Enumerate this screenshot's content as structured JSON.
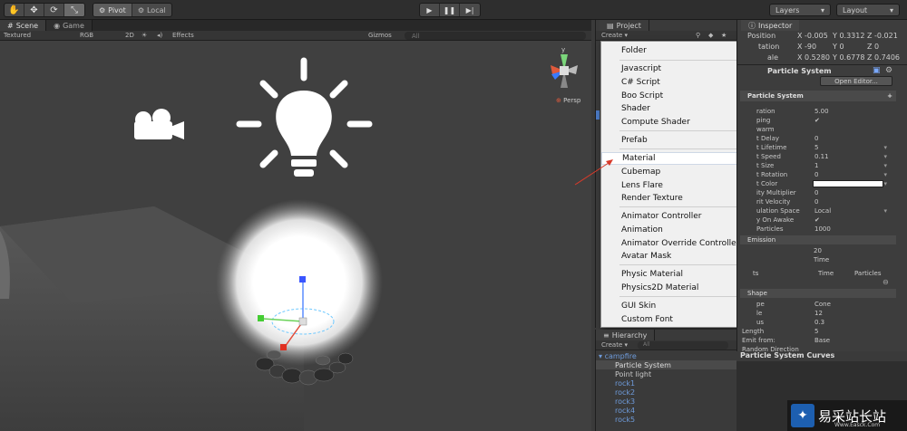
{
  "toolbar": {
    "pivot": "Pivot",
    "local": "Local",
    "layers": "Layers",
    "layout": "Layout"
  },
  "scene": {
    "tab_scene": "Scene",
    "tab_game": "Game",
    "mode": "Textured",
    "rgb": "RGB",
    "twod": "2D",
    "effects": "Effects",
    "gizmos": "Gizmos",
    "search": "All",
    "persp": "Persp",
    "axis_y": "y"
  },
  "project": {
    "tab": "Project",
    "create": "Create"
  },
  "menu": {
    "items": [
      "Folder",
      "Javascript",
      "C# Script",
      "Boo Script",
      "Shader",
      "Compute Shader",
      "Prefab",
      "Material",
      "Cubemap",
      "Lens Flare",
      "Render Texture",
      "Animator Controller",
      "Animation",
      "Animator Override Controller",
      "Avatar Mask",
      "Physic Material",
      "Physics2D Material",
      "GUI Skin",
      "Custom Font"
    ]
  },
  "hierarchy": {
    "tab": "Hierarchy",
    "create": "Create",
    "search": "All",
    "items": [
      "campfire",
      "Particle System",
      "Point light",
      "rock1",
      "rock2",
      "rock3",
      "rock4",
      "rock5"
    ]
  },
  "inspector": {
    "tab": "Inspector",
    "position_label": "Position",
    "rotation_label": "tation",
    "scale_label": "ale",
    "position": {
      "x": "-0.005",
      "y": "0.3312",
      "z": "-0.021"
    },
    "rotation": {
      "x": "-90",
      "y": "0",
      "z": "0"
    },
    "scale": {
      "x": "0.5280",
      "y": "0.6778",
      "z": "0.7406"
    },
    "component_title": "Particle System",
    "open_editor": "Open Editor...",
    "module_title": "Particle System",
    "rows": [
      {
        "label": "ration",
        "value": "5.00"
      },
      {
        "label": "ping",
        "value": "✔"
      },
      {
        "label": "warm",
        "value": ""
      },
      {
        "label": "t Delay",
        "value": "0"
      },
      {
        "label": "t Lifetime",
        "value": "5"
      },
      {
        "label": "t Speed",
        "value": "0.11"
      },
      {
        "label": "t Size",
        "value": "1"
      },
      {
        "label": "t Rotation",
        "value": "0"
      },
      {
        "label": "t Color",
        "value": ""
      },
      {
        "label": "ity Multiplier",
        "value": "0"
      },
      {
        "label": "rit Velocity",
        "value": "0"
      },
      {
        "label": "ulation Space",
        "value": "Local"
      },
      {
        "label": "y On Awake",
        "value": "✔"
      },
      {
        "label": "Particles",
        "value": "1000"
      }
    ],
    "emission": "Emission",
    "rate_value": "20",
    "rate_mode": "Time",
    "bursts_label": "ts",
    "bursts_time": "Time",
    "bursts_particles": "Particles",
    "shape": "Shape",
    "shape_rows": [
      {
        "label": "pe",
        "value": "Cone"
      },
      {
        "label": "le",
        "value": "12"
      },
      {
        "label": "us",
        "value": "0.3"
      },
      {
        "label": "Length",
        "value": "5"
      },
      {
        "label": "Emit from:",
        "value": "Base"
      },
      {
        "label": "Random Direction",
        "value": ""
      }
    ],
    "curves_title": "Particle System Curves"
  },
  "watermark": {
    "text": "易采站长站",
    "url": "Www.Easck.Com"
  }
}
